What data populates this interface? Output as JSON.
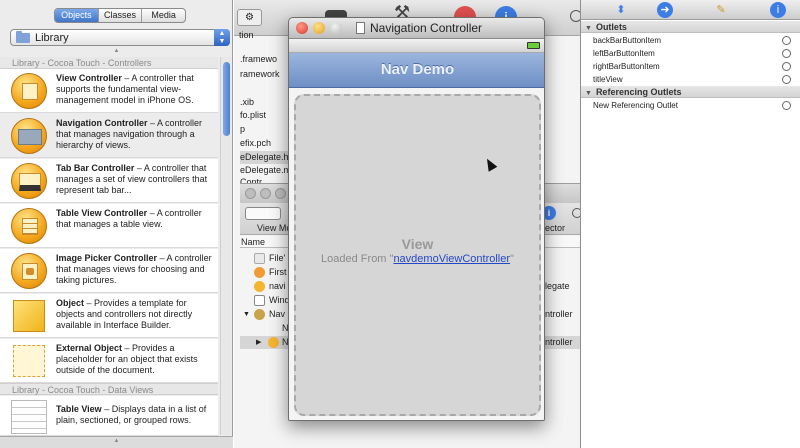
{
  "library": {
    "tabs": [
      {
        "label": "Objects",
        "selected": true
      },
      {
        "label": "Classes",
        "selected": false
      },
      {
        "label": "Media",
        "selected": false
      }
    ],
    "dropdown_label": "Library",
    "sections": [
      {
        "title": "Library - Cocoa Touch - Controllers"
      },
      {
        "title": "Library - Cocoa Touch - Data Views"
      }
    ],
    "items": [
      {
        "name": "View Controller",
        "text": " – A controller that supports the fundamental view-management model in iPhone OS.",
        "icon": "view-controller-icon"
      },
      {
        "name": "Navigation Controller",
        "text": " – A controller that manages navigation through a hierarchy of views.",
        "icon": "navigation-controller-icon"
      },
      {
        "name": "Tab Bar Controller",
        "text": " – A controller that manages a set of view controllers that represent tab bar...",
        "icon": "tab-bar-controller-icon"
      },
      {
        "name": "Table View Controller",
        "text": " – A controller that manages a table view.",
        "icon": "table-view-controller-icon"
      },
      {
        "name": "Image Picker Controller",
        "text": " – A controller that manages views for choosing and taking pictures.",
        "icon": "image-picker-controller-icon"
      },
      {
        "name": "Object",
        "text": " – Provides a template for objects and controllers not directly available in Interface Builder.",
        "icon": "object-cube-icon"
      },
      {
        "name": "External Object",
        "text": " – Provides a placeholder for an object that exists outside of the document.",
        "icon": "external-object-icon"
      },
      {
        "name": "Table View",
        "text": " – Displays data in a list of plain, sectioned, or grouped rows.",
        "icon": "table-view-icon"
      }
    ]
  },
  "xcode": {
    "toolbar_partial_label": "tion",
    "files": [
      ".framewo",
      "ramework",
      ".xib",
      "fo.plist",
      "p",
      "efix.pch",
      "eDelegate.h",
      "eDelegate.m",
      "Contr"
    ],
    "viewmode_label": "View Mo",
    "inspector_label": "pector",
    "name_header": "Name",
    "doc_items": [
      "File'",
      "First",
      "navi",
      "Wind",
      "Nav",
      "N",
      "N"
    ],
    "doc_right": [
      "elegate",
      "ontroller",
      "ontroller"
    ]
  },
  "nav_window": {
    "title": "Navigation Controller",
    "nav_title": "Nav Demo",
    "view_title": "View",
    "loaded_prefix": "Loaded From \"",
    "loaded_link": "navdemoViewController",
    "loaded_suffix": "\""
  },
  "inspector": {
    "outlets_header": "Outlets",
    "outlets": [
      "backBarButtonItem",
      "leftBarButtonItem",
      "rightBarButtonItem",
      "titleView"
    ],
    "ref_header": "Referencing Outlets",
    "ref_items": [
      "New Referencing Outlet"
    ]
  },
  "colors": {
    "accent_blue": "#3d7de6",
    "nav_bar": "#7f9ccf",
    "selected_segment": "#4f83d6"
  }
}
